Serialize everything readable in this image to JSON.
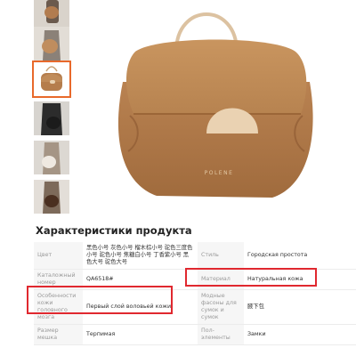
{
  "gallery": {
    "thumbnails": [
      {
        "name": "thumb-1"
      },
      {
        "name": "thumb-2"
      },
      {
        "name": "thumb-3",
        "selected": true
      },
      {
        "name": "thumb-4"
      },
      {
        "name": "thumb-5"
      },
      {
        "name": "thumb-6"
      }
    ],
    "main_image": {
      "brand_mark": "POLENE",
      "bag_color": "#b57d4c",
      "flap_color": "#c08b59",
      "accent_color": "#ead2b2"
    }
  },
  "specs": {
    "title": "Характеристики продукта",
    "rows": [
      {
        "k1": "Цвет",
        "v1": "黑色小号 灰色小号 榴木棕小号 驼色三度色小号 驼色小号 焦糖白小号 丁香紫小号 黑色大号 驼色大号",
        "k2": "Стиль",
        "v2": "Городская простота"
      },
      {
        "k1": "Каталожный номер",
        "v1": "QA6518#",
        "k2": "Материал",
        "v2": "Натуральная кожа"
      },
      {
        "k1": "Особенности кожи головного мозга",
        "v1": "Первый слой воловьей кожи",
        "k2": "Модные фасоны для сумок и сумок",
        "v2": "腋下包"
      },
      {
        "k1": "Размер мешка",
        "v1": "Терпимая",
        "k2": "Пол-элементы",
        "v2": "Замки"
      }
    ]
  },
  "highlight_color": "#e0282f",
  "selected_thumb_color": "#e8692b"
}
